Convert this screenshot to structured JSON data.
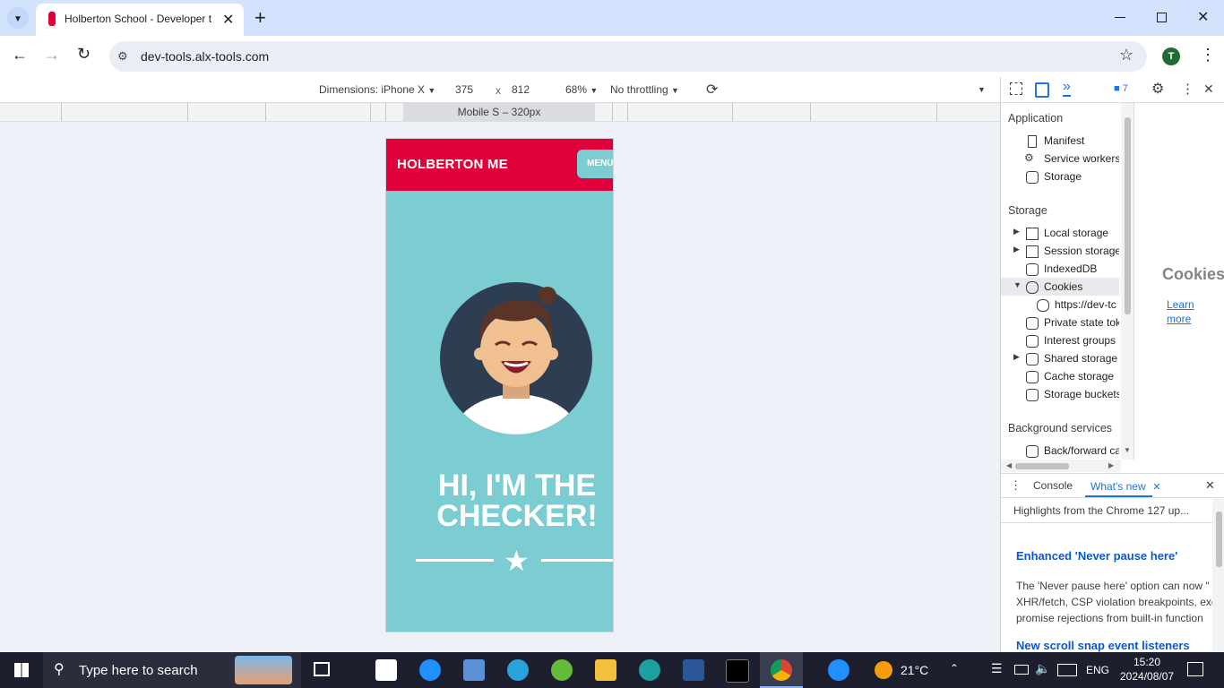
{
  "browser": {
    "tab_title": "Holberton School - Developer t",
    "url": "dev-tools.alx-tools.com",
    "profile_initial": "T"
  },
  "device_toolbar": {
    "dimensions_label": "Dimensions: iPhone X",
    "width": "375",
    "times": "x",
    "height": "812",
    "zoom": "68%",
    "throttling": "No throttling",
    "media_query_label": "Mobile S – 320px"
  },
  "site": {
    "title": "HOLBERTON ME",
    "menu_label": "MENU",
    "hero_line1": "HI, I'M THE",
    "hero_line2": "CHECKER!"
  },
  "devtools": {
    "issues_count": "7",
    "application_heading": "Application",
    "application_items": [
      "Manifest",
      "Service workers",
      "Storage"
    ],
    "storage_heading": "Storage",
    "storage_items": {
      "local": "Local storage",
      "session": "Session storage",
      "indexeddb": "IndexedDB",
      "cookies": "Cookies",
      "cookie_origin": "https://dev-tc",
      "private_state": "Private state tok",
      "interest_groups": "Interest groups",
      "shared": "Shared storage",
      "cache": "Cache storage",
      "buckets": "Storage buckets"
    },
    "background_heading": "Background services",
    "background_items": [
      "Back/forward ca"
    ],
    "cookies_pane": {
      "heading": "Cookies",
      "learn_more": "Learn more"
    },
    "drawer": {
      "tab_console": "Console",
      "tab_whats_new": "What's new",
      "highlights": "Highlights from the Chrome 127 up...",
      "article1_title": "Enhanced 'Never pause here'",
      "article1_line1": "The 'Never pause here' option can now \"",
      "article1_line2": "XHR/fetch, CSP violation breakpoints, exc",
      "article1_line3": "promise rejections from built-in function",
      "article2_title": "New scroll snap event listeners"
    }
  },
  "taskbar": {
    "search_placeholder": "Type here to search",
    "temperature": "21°C",
    "language": "ENG",
    "time": "15:20",
    "date": "2024/08/07"
  },
  "colors": {
    "site_header": "#e0003a",
    "site_body": "#7ccdd2",
    "devtools_accent": "#1a73e8",
    "tabbar": "#d3e3fd"
  }
}
